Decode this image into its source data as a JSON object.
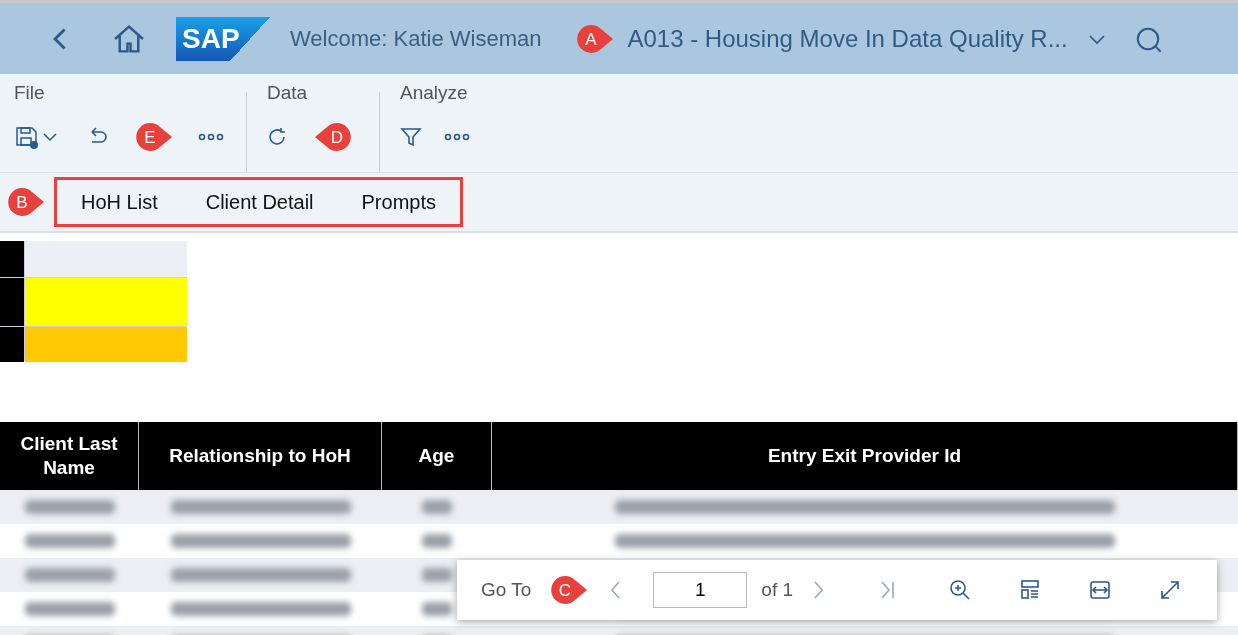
{
  "shell_bar": {
    "logo": "SAP",
    "welcome": "Welcome: Katie Wiseman",
    "title_callout": {
      "label": "A"
    },
    "title": "A013 - Housing Move In Data Quality R..."
  },
  "toolbar": {
    "groups": [
      {
        "label": "File",
        "items": [
          {
            "kind": "save"
          },
          {
            "kind": "undo"
          },
          {
            "kind": "callout",
            "label": "E"
          },
          {
            "kind": "more"
          }
        ]
      },
      {
        "label": "Data",
        "items": [
          {
            "kind": "refresh"
          },
          {
            "kind": "callout_left",
            "label": "D"
          }
        ]
      },
      {
        "label": "Analyze",
        "items": [
          {
            "kind": "filter"
          },
          {
            "kind": "more"
          }
        ]
      }
    ]
  },
  "tabs_callout": {
    "label": "B"
  },
  "tabs": [
    {
      "label": "HoH List"
    },
    {
      "label": "Client Detail"
    },
    {
      "label": "Prompts"
    }
  ],
  "table": {
    "columns": [
      "Client Last Name",
      "Relationship to HoH",
      "Age",
      "Entry Exit Provider Id"
    ]
  },
  "pager": {
    "label": "Go To",
    "callout": {
      "label": "C"
    },
    "page": "1",
    "of": "of 1"
  }
}
